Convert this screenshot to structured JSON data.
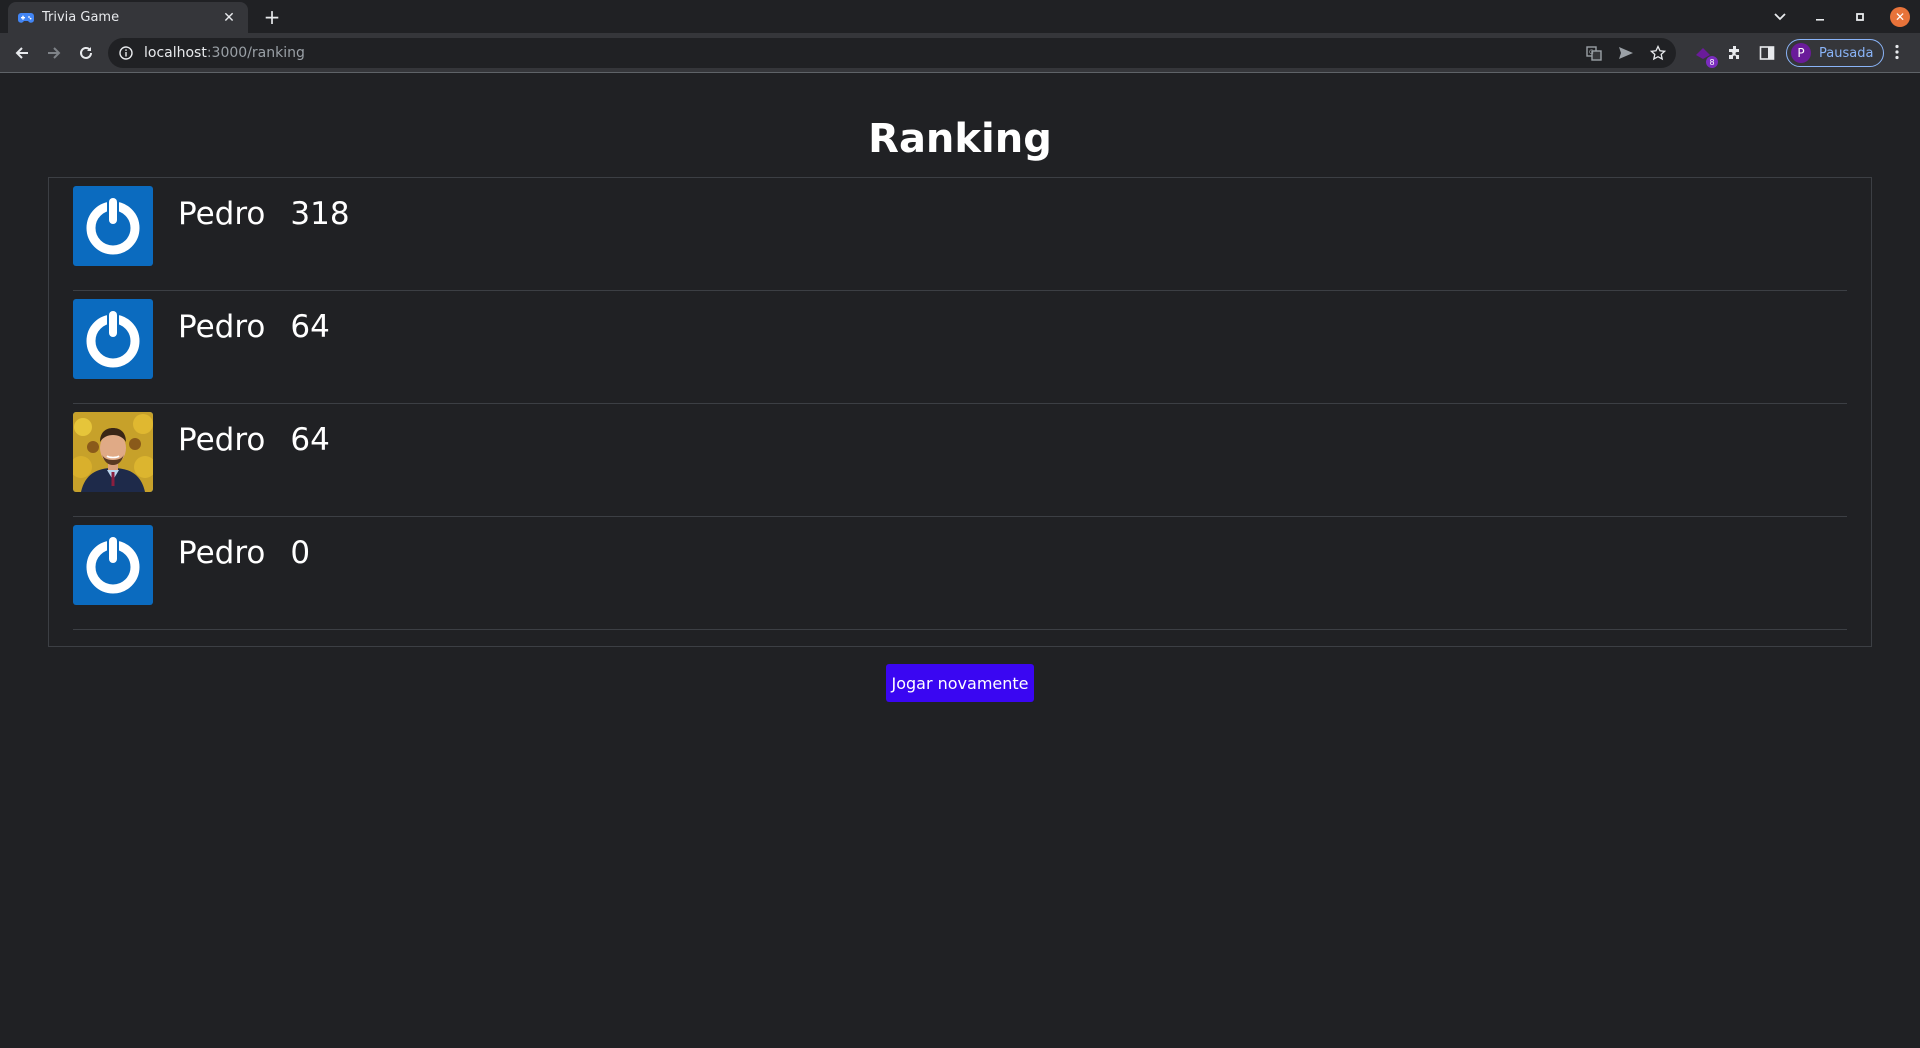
{
  "browser": {
    "tab": {
      "title": "Trivia Game"
    },
    "url": {
      "host": "localhost",
      "path": ":3000/ranking"
    },
    "extensions_badge": "8",
    "profile": {
      "initial": "P",
      "label": "Pausada"
    }
  },
  "page": {
    "title": "Ranking",
    "players": [
      {
        "name": "Pedro",
        "score": "318",
        "avatar": "power-icon"
      },
      {
        "name": "Pedro",
        "score": "64",
        "avatar": "power-icon"
      },
      {
        "name": "Pedro",
        "score": "64",
        "avatar": "photo"
      },
      {
        "name": "Pedro",
        "score": "0",
        "avatar": "power-icon"
      }
    ],
    "play_again_label": "Jogar novamente"
  },
  "colors": {
    "background": "#202124",
    "button": "#3a06f2",
    "avatar_blue": "#0b6bbf",
    "profile_accent": "#8ab4f8"
  }
}
